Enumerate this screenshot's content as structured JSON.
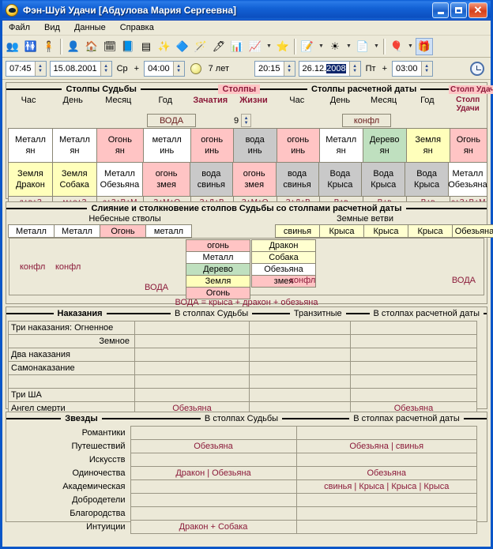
{
  "window": {
    "title": "Фэн-Шуй Удачи [Абдулова Мария Сергеевна]",
    "minimize_label": "",
    "maximize_label": "",
    "close_label": "✕"
  },
  "menu": {
    "items": [
      "Файл",
      "Вид",
      "Данные",
      "Справка"
    ]
  },
  "toolbar": {
    "icons": [
      "people-group-icon",
      "person-split-icon",
      "person-arrow-icon",
      "user-pair-icon",
      "house-icon",
      "calendar-icon",
      "book-icon",
      "table-icon",
      "stars-icon",
      "info-diamond-icon",
      "magic-wand-icon",
      "pen-icon",
      "bar-chart-icon",
      "chart-edit-icon",
      "star-icon",
      "note-edit-icon",
      "sun-burst-icon",
      "text-list-icon",
      "balloons-icon",
      "gift-icon"
    ]
  },
  "datebar": {
    "birth_time": "07:45",
    "birth_date": "15.08.2001",
    "birth_weekday": "Ср",
    "plus1": "+",
    "offset1": "04:00",
    "moon_icon": "moon-icon",
    "age": "7 лет",
    "calc_time": "20:15",
    "calc_date_prefix": "26.12.",
    "calc_date_selected": "2008",
    "calc_weekday": "Пт",
    "plus2": "+",
    "offset2": "03:00",
    "clock_icon": "clock-icon"
  },
  "pillars": {
    "legend_fate": "Столпы Судьбы",
    "legend_stolpy": "Столпы",
    "legend_calc": "Столпы расчетной даты",
    "legend_luck": "Столп Удачи",
    "headers_fate": [
      "Час",
      "День",
      "Месяц",
      "Год"
    ],
    "headers_extra": [
      "Зачатия",
      "Жизни"
    ],
    "headers_calc": [
      "Час",
      "День",
      "Месяц",
      "Год"
    ],
    "conception_value": "9",
    "tag_fate": "ВОДА",
    "tag_calc": "конфл",
    "stems": [
      {
        "el": "Металл",
        "pol": "ян",
        "color": "w"
      },
      {
        "el": "Металл",
        "pol": "ян",
        "color": "w"
      },
      {
        "el": "Огонь",
        "pol": "ян",
        "color": "red"
      },
      {
        "el": "металл",
        "pol": "инь",
        "color": "w"
      },
      {
        "el": "огонь",
        "pol": "инь",
        "color": "red"
      },
      {
        "el": "вода",
        "pol": "инь",
        "color": "gray"
      },
      {
        "el": "огонь",
        "pol": "инь",
        "color": "red"
      },
      {
        "el": "Металл",
        "pol": "ян",
        "color": "w"
      },
      {
        "el": "Дерево",
        "pol": "ян",
        "color": "green"
      },
      {
        "el": "Земля",
        "pol": "ян",
        "color": "yellow"
      },
      {
        "el": "Огонь",
        "pol": "ян",
        "color": "red"
      }
    ],
    "branches": [
      {
        "el": "Земля",
        "animal": "Дракон",
        "color": "yellow"
      },
      {
        "el": "Земля",
        "animal": "Собака",
        "color": "yellow"
      },
      {
        "el": "Металл",
        "animal": "Обезьяна",
        "color": "w"
      },
      {
        "el": "огонь",
        "animal": "змея",
        "color": "red"
      },
      {
        "el": "вода",
        "animal": "свинья",
        "color": "gray"
      },
      {
        "el": "огонь",
        "animal": "змея",
        "color": "red"
      },
      {
        "el": "вода",
        "animal": "свинья",
        "color": "gray"
      },
      {
        "el": "Вода",
        "animal": "Крыса",
        "color": "gray"
      },
      {
        "el": "Вода",
        "animal": "Крыса",
        "color": "gray"
      },
      {
        "el": "Вода",
        "animal": "Крыса",
        "color": "gray"
      },
      {
        "el": "Металл",
        "animal": "Обезьяна",
        "color": "w"
      }
    ],
    "sums": [
      "д+в+З",
      "м+о+З",
      "з+З+В+М",
      "З+М+О",
      "З+Д+В",
      "З+М+О",
      "З+Д+В",
      "В+в",
      "В+в",
      "В+в",
      "з+З+В+М"
    ],
    "bottom_tags": [
      "конфл",
      "ВОДА"
    ]
  },
  "merge": {
    "legend": "Слияние и столкновение столпов Судьбы со столпами расчетной даты",
    "sub_left": "Небесные стволы",
    "sub_right": "Земные ветви",
    "stems_row": [
      {
        "t": "Металл",
        "color": "w"
      },
      {
        "t": "Металл",
        "color": "w"
      },
      {
        "t": "Огонь",
        "color": "red"
      },
      {
        "t": "металл",
        "color": "w"
      }
    ],
    "branches_row": [
      {
        "t": "свинья",
        "color": "lyellow"
      },
      {
        "t": "Крыса",
        "color": "lyellow"
      },
      {
        "t": "Крыса",
        "color": "lyellow"
      },
      {
        "t": "Крыса",
        "color": "lyellow"
      },
      {
        "t": "Обезьяна",
        "color": "lyellow"
      }
    ],
    "konfl_left_1": "конфл",
    "konfl_left_2": "конфл",
    "voda_left": "ВОДА",
    "col_elements": [
      {
        "t": "огонь",
        "color": "red"
      },
      {
        "t": "Металл",
        "color": "w"
      },
      {
        "t": "Дерево",
        "color": "green"
      },
      {
        "t": "Земля",
        "color": "yellow"
      },
      {
        "t": "Огонь",
        "color": "red"
      }
    ],
    "col_animals": [
      {
        "t": "Дракон",
        "color": "lyellow"
      },
      {
        "t": "Собака",
        "color": "lyellow"
      },
      {
        "t": "Обезьяна",
        "color": "w"
      },
      {
        "t": "змея",
        "color": "red"
      }
    ],
    "konfl_mid": "конфл",
    "voda_right": "ВОДА",
    "formula": "ВОДА = крыса + дракон + обезьяна"
  },
  "punishments": {
    "legend": "Наказания",
    "col_fate": "В столпах Судьбы",
    "col_transit": "Транзитные",
    "col_calc": "В столпах расчетной даты",
    "rows": [
      {
        "label": "Три наказания: Огненное",
        "align": "left",
        "fate": "",
        "transit": "",
        "calc": ""
      },
      {
        "label": "Земное",
        "align": "right",
        "fate": "",
        "transit": "",
        "calc": ""
      },
      {
        "label": "Два наказания",
        "align": "left",
        "fate": "",
        "transit": "",
        "calc": ""
      },
      {
        "label": "Самонаказание",
        "align": "left",
        "fate": "",
        "transit": "",
        "calc": ""
      },
      {
        "label": "",
        "align": "left",
        "fate": "",
        "transit": "",
        "calc": ""
      },
      {
        "label": "Три ША",
        "align": "left",
        "fate": "",
        "transit": "",
        "calc": ""
      },
      {
        "label": "Ангел смерти",
        "align": "left",
        "fate": "Обезьяна",
        "transit": "",
        "calc": "Обезьяна"
      }
    ]
  },
  "stars": {
    "legend": "Звезды",
    "col_fate": "В столпах Судьбы",
    "col_calc": "В столпах расчетной даты",
    "rows": [
      {
        "label": "Романтики",
        "fate": "",
        "calc": ""
      },
      {
        "label": "Путешествий",
        "fate": "Обезьяна",
        "calc": "Обезьяна | свинья"
      },
      {
        "label": "Искусств",
        "fate": "",
        "calc": ""
      },
      {
        "label": "Одиночества",
        "fate": "Дракон | Обезьяна",
        "calc": "Обезьяна"
      },
      {
        "label": "Академическая",
        "fate": "",
        "calc": "свинья | Крыса | Крыса | Крыса"
      },
      {
        "label": "Добродетели",
        "fate": "",
        "calc": ""
      },
      {
        "label": "Благородства",
        "fate": "",
        "calc": ""
      },
      {
        "label": "Интуиции",
        "fate": "Дракон + Собака",
        "calc": ""
      }
    ]
  },
  "colors": {
    "fire": "#ffc4c4",
    "water": "#c9c9c9",
    "earth": "#ffffbb",
    "wood": "#bfe0bf",
    "metal": "#ffffff",
    "accent_red": "#8b1a3a",
    "window_bg": "#ece9d8",
    "title_blue": "#0a5bd3"
  }
}
